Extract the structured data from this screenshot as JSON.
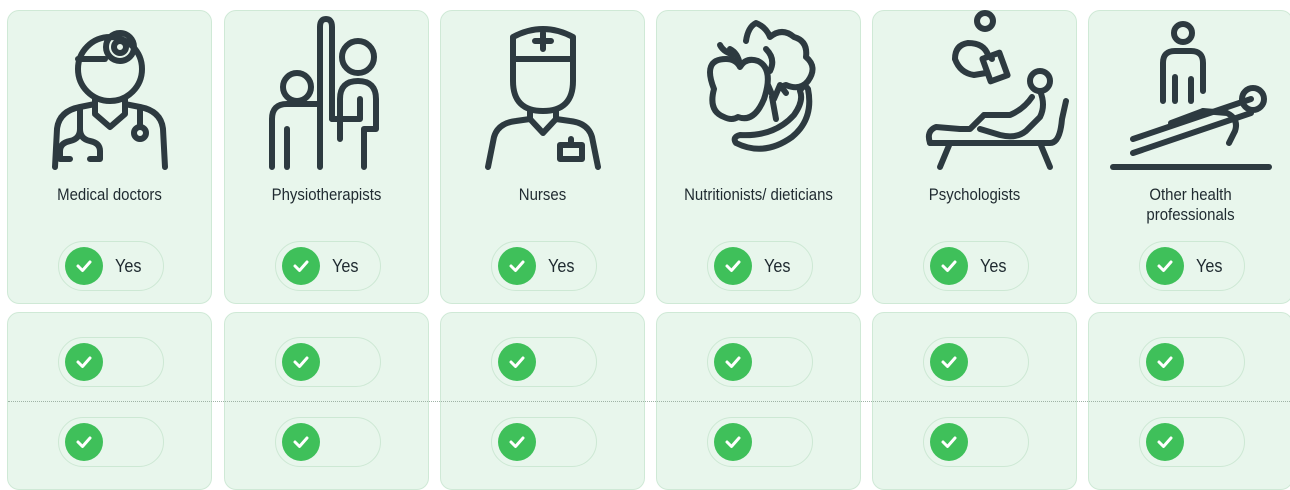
{
  "colors": {
    "card_background": "#e8f6ec",
    "card_border": "#cfe9d6",
    "check_green": "#3fc05a",
    "icon_stroke": "#2d3a40"
  },
  "professions": [
    {
      "label": "Medical doctors",
      "icon": "doctor-icon",
      "status": "Yes"
    },
    {
      "label": "Physiotherapists",
      "icon": "physiotherapist-icon",
      "status": "Yes"
    },
    {
      "label": "Nurses",
      "icon": "nurse-icon",
      "status": "Yes"
    },
    {
      "label": "Nutritionists/ dieticians",
      "icon": "nutritionist-icon",
      "status": "Yes"
    },
    {
      "label": "Psychologists",
      "icon": "psychologist-icon",
      "status": "Yes"
    },
    {
      "label": "Other health professionals",
      "icon": "health-professional-icon",
      "status": "Yes"
    }
  ]
}
